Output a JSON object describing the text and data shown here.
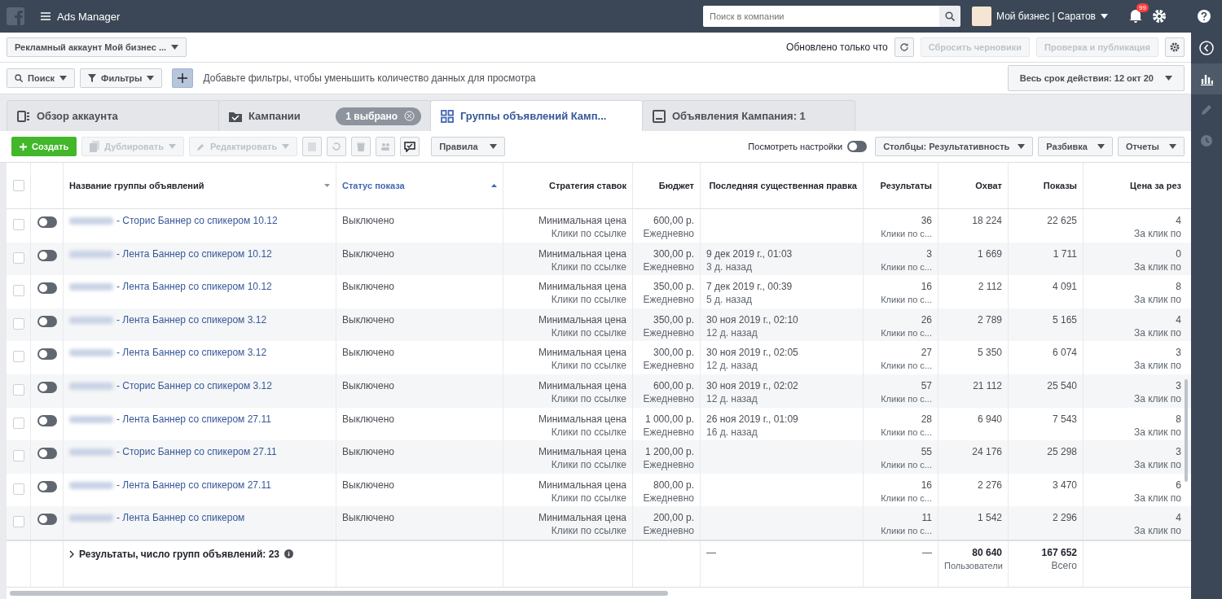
{
  "topbar": {
    "title": "Ads Manager",
    "search_placeholder": "Поиск в компании",
    "account": "Мой бизнес | Саратов",
    "notifications": "99"
  },
  "account_bar": {
    "account": "Рекламный аккаунт Мой бизнес ...",
    "updated": "Обновлено только что",
    "buttons": [
      {
        "label": "Сбросить черновики",
        "disabled": true
      },
      {
        "label": "Проверка и публикация",
        "disabled": true
      }
    ]
  },
  "filter_bar": {
    "search": "Поиск",
    "filters": "Фильтры",
    "hint": "Добавьте фильтры, чтобы уменьшить количество данных для просмотра",
    "date_range": "Весь срок действия: 12 окт 20"
  },
  "tabs": [
    {
      "label": "Обзор аккаунта",
      "selected": false,
      "kind": "overview"
    },
    {
      "label": "Кампании",
      "selected": false,
      "kind": "campaigns",
      "badge": "1 выбрано"
    },
    {
      "label": "Группы объявлений Камп...",
      "selected": true,
      "kind": "adsets"
    },
    {
      "label": "Объявления Кампания: 1",
      "selected": false,
      "kind": "ads"
    }
  ],
  "toolbar": {
    "create": "Создать",
    "duplicate": {
      "label": "Дублировать",
      "disabled": true
    },
    "edit": {
      "label": "Редактировать",
      "disabled": true
    },
    "rules": "Правила",
    "view_settings": {
      "label": "Посмотреть настройки",
      "on": false
    },
    "columns": "Столбцы: Результативность",
    "breakdown": "Разбивка",
    "reports": "Отчеты"
  },
  "table": {
    "all_checked": false,
    "columns": [
      {
        "label": "Название группы объявлений",
        "sorted": false
      },
      {
        "label": "Статус показа",
        "sorted": true
      },
      {
        "label": "Стратегия ставок",
        "sorted": false
      },
      {
        "label": "Бюджет",
        "sorted": false
      },
      {
        "label": "Последняя существенная правка",
        "sorted": false
      },
      {
        "label": "Результаты",
        "sorted": false
      },
      {
        "label": "Охват",
        "sorted": false
      },
      {
        "label": "Показы",
        "sorted": false
      },
      {
        "label": "Цена за рез",
        "sorted": false
      }
    ],
    "rows": [
      {
        "checked": false,
        "on": false,
        "name": "- Сторис Баннер со спикером 10.12",
        "status": "Выключено",
        "strategy": "Минимальная цена",
        "strategy_sub": "Клики по ссылке",
        "budget": "600,00 р.",
        "budget_period": "Ежедневно",
        "results": "36",
        "results_sub": "Клики по с...",
        "reach": "18 224",
        "impressions": "22 625",
        "price": "4",
        "price_sub": "За клик по"
      },
      {
        "checked": false,
        "on": false,
        "name": "- Лента Баннер со спикером 10.12",
        "status": "Выключено",
        "strategy": "Минимальная цена",
        "strategy_sub": "Клики по ссылке",
        "budget": "300,00 р.",
        "budget_period": "Ежедневно",
        "edit_date": "9 дек 2019 г., 01:03",
        "edit_ago": "3 д. назад",
        "results": "3",
        "results_sub": "Клики по с...",
        "reach": "1 669",
        "impressions": "1 711",
        "price": "0",
        "price_sub": "За клик по"
      },
      {
        "checked": false,
        "on": false,
        "name": "- Лента Баннер со спикером 10.12",
        "status": "Выключено",
        "strategy": "Минимальная цена",
        "strategy_sub": "Клики по ссылке",
        "budget": "350,00 р.",
        "budget_period": "Ежедневно",
        "edit_date": "7 дек 2019 г., 00:39",
        "edit_ago": "5 д. назад",
        "results": "16",
        "results_sub": "Клики по с...",
        "reach": "2 112",
        "impressions": "4 091",
        "price": "8",
        "price_sub": "За клик по"
      },
      {
        "checked": false,
        "on": false,
        "name": "- Лента Баннер со спикером 3.12",
        "status": "Выключено",
        "strategy": "Минимальная цена",
        "strategy_sub": "Клики по ссылке",
        "budget": "350,00 р.",
        "budget_period": "Ежедневно",
        "edit_date": "30 ноя 2019 г., 02:10",
        "edit_ago": "12 д. назад",
        "results": "26",
        "results_sub": "Клики по с...",
        "reach": "2 789",
        "impressions": "5 165",
        "price": "4",
        "price_sub": "За клик по"
      },
      {
        "checked": false,
        "on": false,
        "name": "- Лента Баннер со спикером 3.12",
        "status": "Выключено",
        "strategy": "Минимальная цена",
        "strategy_sub": "Клики по ссылке",
        "budget": "300,00 р.",
        "budget_period": "Ежедневно",
        "edit_date": "30 ноя 2019 г., 02:05",
        "edit_ago": "12 д. назад",
        "results": "27",
        "results_sub": "Клики по с...",
        "reach": "5 350",
        "impressions": "6 074",
        "price": "3",
        "price_sub": "За клик по"
      },
      {
        "checked": false,
        "on": false,
        "name": "- Сторис Баннер со спикером 3.12",
        "status": "Выключено",
        "strategy": "Минимальная цена",
        "strategy_sub": "Клики по ссылке",
        "budget": "600,00 р.",
        "budget_period": "Ежедневно",
        "edit_date": "30 ноя 2019 г., 02:02",
        "edit_ago": "12 д. назад",
        "results": "57",
        "results_sub": "Клики по с...",
        "reach": "21 112",
        "impressions": "25 540",
        "price": "3",
        "price_sub": "За клик по"
      },
      {
        "checked": false,
        "on": false,
        "name": "- Лента Баннер со спикером 27.11",
        "status": "Выключено",
        "strategy": "Минимальная цена",
        "strategy_sub": "Клики по ссылке",
        "budget": "1 000,00 р.",
        "budget_period": "Ежедневно",
        "edit_date": "26 ноя 2019 г., 01:09",
        "edit_ago": "16 д. назад",
        "results": "28",
        "results_sub": "Клики по с...",
        "reach": "6 940",
        "impressions": "7 543",
        "price": "8",
        "price_sub": "За клик по"
      },
      {
        "checked": false,
        "on": false,
        "name": "- Сторис Баннер со спикером 27.11",
        "status": "Выключено",
        "strategy": "Минимальная цена",
        "strategy_sub": "Клики по ссылке",
        "budget": "1 200,00 р.",
        "budget_period": "Ежедневно",
        "results": "55",
        "results_sub": "Клики по с...",
        "reach": "24 176",
        "impressions": "25 298",
        "price": "3",
        "price_sub": "За клик по"
      },
      {
        "checked": false,
        "on": false,
        "name": "- Лента Баннер со спикером 27.11",
        "status": "Выключено",
        "strategy": "Минимальная цена",
        "strategy_sub": "Клики по ссылке",
        "budget": "800,00 р.",
        "budget_period": "Ежедневно",
        "results": "16",
        "results_sub": "Клики по с...",
        "reach": "2 276",
        "impressions": "3 470",
        "price": "6",
        "price_sub": "За клик по"
      },
      {
        "checked": false,
        "on": false,
        "name": "- Лента Баннер со спикером",
        "status": "Выключено",
        "strategy": "Минимальная цена",
        "strategy_sub": "Клики по ссылке",
        "budget": "200,00 р.",
        "budget_period": "Ежедневно",
        "results": "11",
        "results_sub": "Клики по с...",
        "reach": "1 542",
        "impressions": "2 296",
        "price": "4",
        "price_sub": "За клик по"
      }
    ],
    "footer": {
      "summary": "Результаты, число групп объявлений: 23",
      "edit": "—",
      "results": "—",
      "reach": "80 640",
      "reach_sub": "Пользователи",
      "impressions": "167 652",
      "impressions_sub": "Всего"
    }
  },
  "side_panel": {
    "items": [
      {
        "kind": "collapse",
        "selected": false
      },
      {
        "kind": "chart",
        "selected": true
      },
      {
        "kind": "edit",
        "selected": false
      },
      {
        "kind": "history",
        "selected": false
      }
    ]
  }
}
